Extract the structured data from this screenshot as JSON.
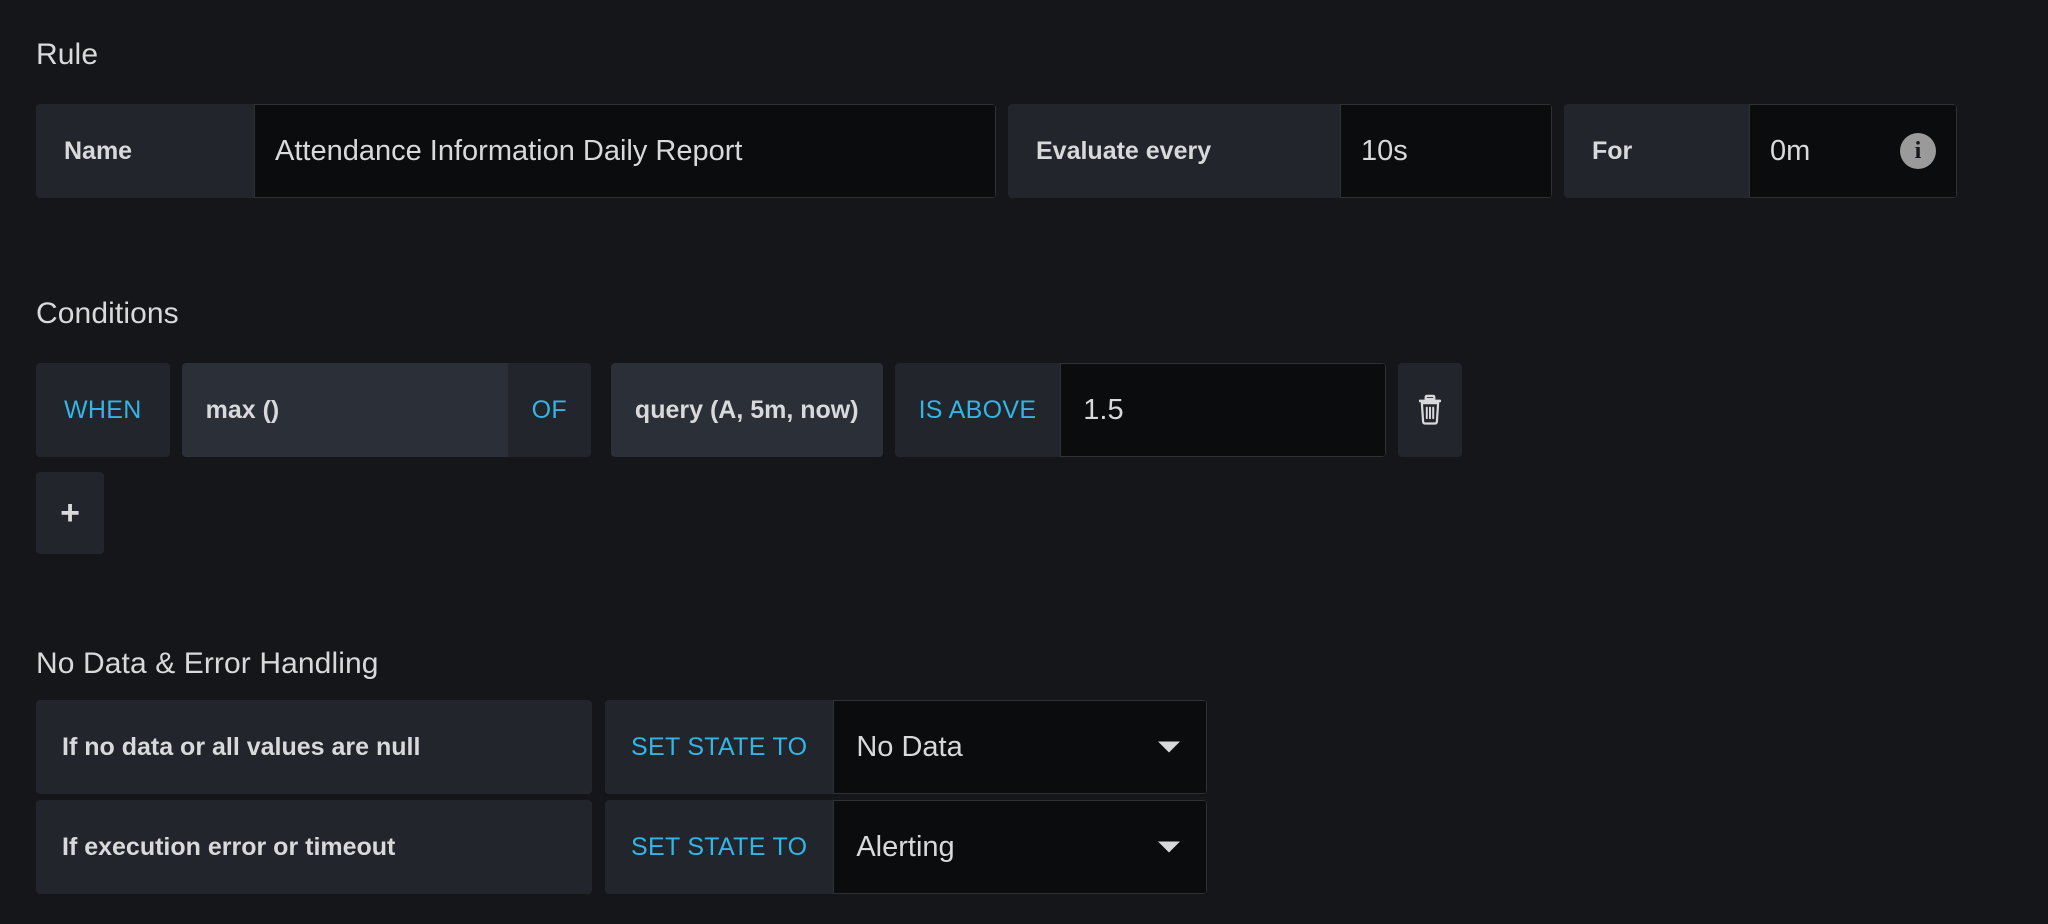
{
  "rule": {
    "heading": "Rule",
    "name_label": "Name",
    "name_value": "Attendance Information Daily Report",
    "evaluate_label": "Evaluate every",
    "evaluate_value": "10s",
    "for_label": "For",
    "for_value": "0m",
    "info_glyph": "i"
  },
  "conditions": {
    "heading": "Conditions",
    "when_label": "WHEN",
    "reducer_value": "max ()",
    "of_label": "OF",
    "query_value": "query (A, 5m, now)",
    "evaluator_label": "IS ABOVE",
    "threshold_value": "1.5",
    "delete_icon": "trash-icon",
    "add_label": "+"
  },
  "handling": {
    "heading": "No Data & Error Handling",
    "rows": [
      {
        "description": "If no data or all values are null",
        "set_state_label": "SET STATE TO",
        "state_value": "No Data"
      },
      {
        "description": "If execution error or timeout",
        "set_state_label": "SET STATE TO",
        "state_value": "Alerting"
      }
    ]
  },
  "colors": {
    "background": "#141619",
    "panel": "#22252b",
    "panel_light": "#2b2f38",
    "input": "#0b0c0e",
    "accent": "#33b5e5",
    "text": "#d8d9da"
  }
}
